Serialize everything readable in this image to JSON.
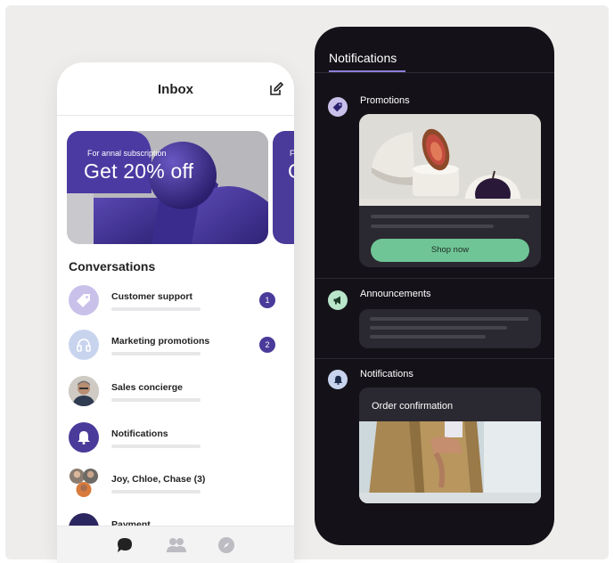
{
  "inbox": {
    "title": "Inbox",
    "promo": {
      "kicker": "For annal subscription",
      "headline": "Get 20% off"
    },
    "promo_next": {
      "kicker_partial": "F",
      "headline_partial": "G"
    },
    "conversations_title": "Conversations",
    "conversations": [
      {
        "name": "Customer support",
        "badge": "1"
      },
      {
        "name": "Marketing promotions",
        "badge": "2"
      },
      {
        "name": "Sales concierge"
      },
      {
        "name": "Notifications"
      },
      {
        "name": "Joy, Chloe, Chase (3)"
      },
      {
        "name": "Payment"
      }
    ]
  },
  "notifications": {
    "title": "Notifications",
    "sections": [
      {
        "title": "Promotions",
        "button": "Shop now"
      },
      {
        "title": "Announcements"
      },
      {
        "title": "Notifications",
        "card_title": "Order confirmation"
      }
    ]
  },
  "colors": {
    "accent": "#4a3a9a",
    "dark_bg": "#141218",
    "panel": "#2a2830",
    "cta": "#6fc596"
  },
  "icons": [
    "edit-icon",
    "tag-icon",
    "headphones-icon",
    "bell-icon",
    "megaphone-icon",
    "chat-icon",
    "people-icon",
    "compass-icon"
  ]
}
